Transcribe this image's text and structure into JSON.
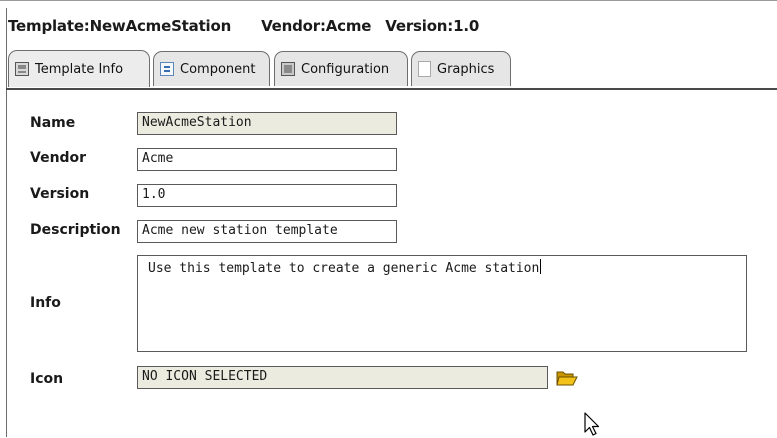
{
  "header": {
    "template": "Template:NewAcmeStation",
    "vendor": "Vendor:Acme",
    "version": "Version:1.0"
  },
  "tabs": [
    {
      "label": "Template Info",
      "icon": "info-sheet-icon",
      "active": true
    },
    {
      "label": "Component",
      "icon": "component-icon",
      "active": false
    },
    {
      "label": "Configuration",
      "icon": "configuration-icon",
      "active": false
    },
    {
      "label": "Graphics",
      "icon": "graphics-page-icon",
      "active": false
    }
  ],
  "form": {
    "name_label": "Name",
    "name_value": "NewAcmeStation",
    "vendor_label": "Vendor",
    "vendor_value": "Acme",
    "version_label": "Version",
    "version_value": "1.0",
    "description_label": "Description",
    "description_value": "Acme new station template",
    "info_label": "Info",
    "info_value": "Use this template to create a generic Acme station",
    "icon_label": "Icon",
    "icon_value": "NO ICON SELECTED"
  },
  "colors": {
    "readonly_field": "#ecebdf",
    "tab_background": "#e6e6e6",
    "folder_icon": "#e8b400"
  }
}
